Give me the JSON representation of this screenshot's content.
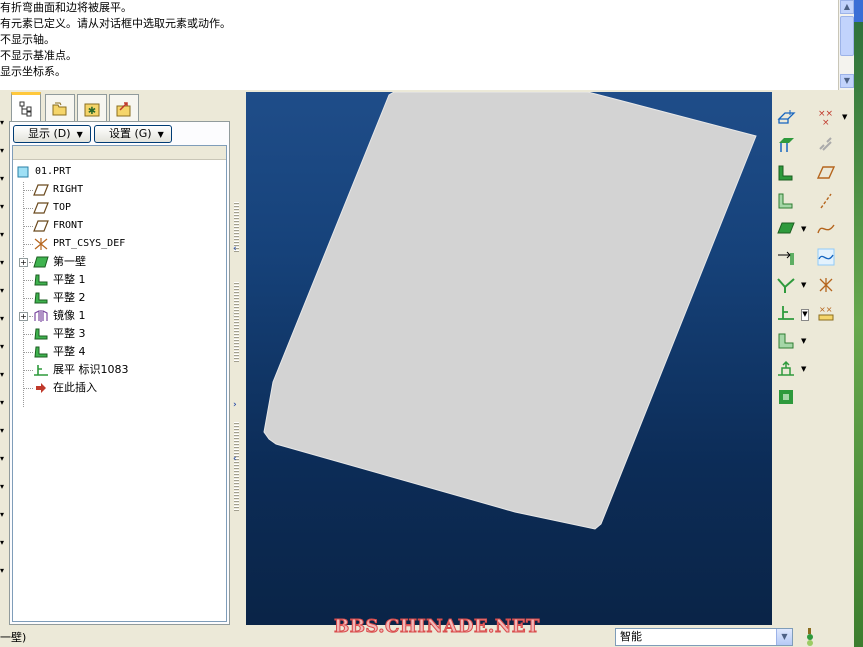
{
  "messages": [
    "有折弯曲面和边将被展平。",
    "有元素已定义。请从对话框中选取元素或动作。",
    "不显示轴。",
    "不显示基准点。",
    "显示坐标系。"
  ],
  "panel": {
    "show_menu_label": "显示 (D)",
    "settings_menu_label": "设置 (G)"
  },
  "model_tree": {
    "root": "01.PRT",
    "items": [
      {
        "label": "RIGHT",
        "icon": "datum-plane-icon"
      },
      {
        "label": "TOP",
        "icon": "datum-plane-icon"
      },
      {
        "label": "FRONT",
        "icon": "datum-plane-icon"
      },
      {
        "label": "PRT_CSYS_DEF",
        "icon": "csys-icon"
      },
      {
        "label": "第一壁",
        "icon": "first-wall-icon"
      },
      {
        "label": "平整 1",
        "icon": "flat-wall-icon"
      },
      {
        "label": "平整 2",
        "icon": "flat-wall-icon"
      },
      {
        "label": "镜像 1",
        "icon": "mirror-icon"
      },
      {
        "label": "平整 3",
        "icon": "flat-wall-icon"
      },
      {
        "label": "平整 4",
        "icon": "flat-wall-icon"
      },
      {
        "label": "展平 标识1083",
        "icon": "unbend-icon"
      },
      {
        "label": "在此插入",
        "icon": "insert-here-arrow-icon"
      }
    ]
  },
  "status": {
    "left_text": "一壁)",
    "watermark": "BBS.CHINADE.NET",
    "filter_value": "智能"
  },
  "colors": {
    "viewport_top": "#1f4d89",
    "viewport_bottom": "#0a2447",
    "part_fill": "#d3d3d3",
    "watermark": "#d94c4c",
    "tool_green": "#2e9a3c"
  }
}
